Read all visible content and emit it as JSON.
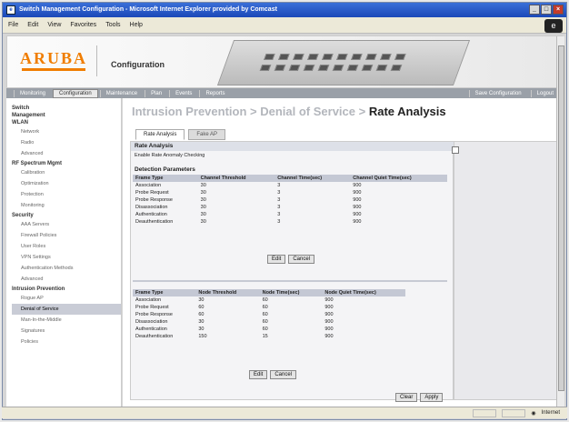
{
  "window": {
    "title": "Switch Management Configuration - Microsoft Internet Explorer provided by Comcast"
  },
  "menu": [
    "File",
    "Edit",
    "View",
    "Favorites",
    "Tools",
    "Help"
  ],
  "banner": {
    "logo": "ARUBA",
    "title": "Configuration"
  },
  "nav": {
    "tabs": [
      "Monitoring",
      "Configuration",
      "Maintenance",
      "Plan",
      "Events",
      "Reports"
    ],
    "active": "Configuration",
    "save": "Save Configuration",
    "logout": "Logout"
  },
  "sidebar": [
    {
      "type": "h",
      "label": "Switch"
    },
    {
      "type": "h",
      "label": "Management"
    },
    {
      "type": "h",
      "label": "WLAN"
    },
    {
      "type": "i",
      "label": "Network"
    },
    {
      "type": "i",
      "label": "Radio"
    },
    {
      "type": "i",
      "label": "Advanced"
    },
    {
      "type": "h",
      "label": "RF Spectrum Mgmt"
    },
    {
      "type": "i",
      "label": "Calibration"
    },
    {
      "type": "i",
      "label": "Optimization"
    },
    {
      "type": "i",
      "label": "Protection"
    },
    {
      "type": "i",
      "label": "Monitoring"
    },
    {
      "type": "h",
      "label": "Security"
    },
    {
      "type": "i",
      "label": "AAA Servers"
    },
    {
      "type": "i",
      "label": "Firewall Policies"
    },
    {
      "type": "i",
      "label": "User Roles"
    },
    {
      "type": "i",
      "label": "VPN Settings"
    },
    {
      "type": "i",
      "label": "Authentication Methods"
    },
    {
      "type": "i",
      "label": "Advanced"
    },
    {
      "type": "h",
      "label": "Intrusion Prevention"
    },
    {
      "type": "i",
      "label": "Rogue AP"
    },
    {
      "type": "i",
      "label": "Denial of Service",
      "active": true
    },
    {
      "type": "i",
      "label": "Man-In-the-Middle"
    },
    {
      "type": "i",
      "label": "Signatures"
    },
    {
      "type": "i",
      "label": "Policies"
    }
  ],
  "breadcrumb": {
    "part1": "Intrusion Prevention",
    "sep1": " > ",
    "part2": "Denial of Service",
    "sep2": " > ",
    "current": "Rate Analysis"
  },
  "tabs": [
    "Rate Analysis",
    "Fake AP"
  ],
  "panel": {
    "header": "Rate Analysis",
    "enable_label": "Enable Rate Anomaly Checking",
    "detection_header": "Detection Parameters"
  },
  "table1": {
    "headers": [
      "Frame Type",
      "Channel Threshold",
      "Channel Time(sec)",
      "Channel Quiet Time(sec)"
    ],
    "rows": [
      [
        "Association",
        "30",
        "3",
        "900"
      ],
      [
        "Probe Request",
        "30",
        "3",
        "900"
      ],
      [
        "Probe Response",
        "30",
        "3",
        "900"
      ],
      [
        "Disassociation",
        "30",
        "3",
        "900"
      ],
      [
        "Authentication",
        "30",
        "3",
        "900"
      ],
      [
        "Deauthentication",
        "30",
        "3",
        "900"
      ]
    ]
  },
  "table2": {
    "headers": [
      "Frame Type",
      "Node Threshold",
      "Node Time(sec)",
      "Node Quiet Time(sec)"
    ],
    "rows": [
      [
        "Association",
        "30",
        "60",
        "900"
      ],
      [
        "Probe Request",
        "60",
        "60",
        "900"
      ],
      [
        "Probe Response",
        "60",
        "60",
        "900"
      ],
      [
        "Disassociation",
        "30",
        "60",
        "900"
      ],
      [
        "Authentication",
        "30",
        "60",
        "900"
      ],
      [
        "Deauthentication",
        "150",
        "15",
        "900"
      ]
    ]
  },
  "buttons": {
    "edit": "Edit",
    "cancel": "Cancel",
    "clear": "Clear",
    "apply": "Apply"
  },
  "status": {
    "zone": "Internet"
  }
}
